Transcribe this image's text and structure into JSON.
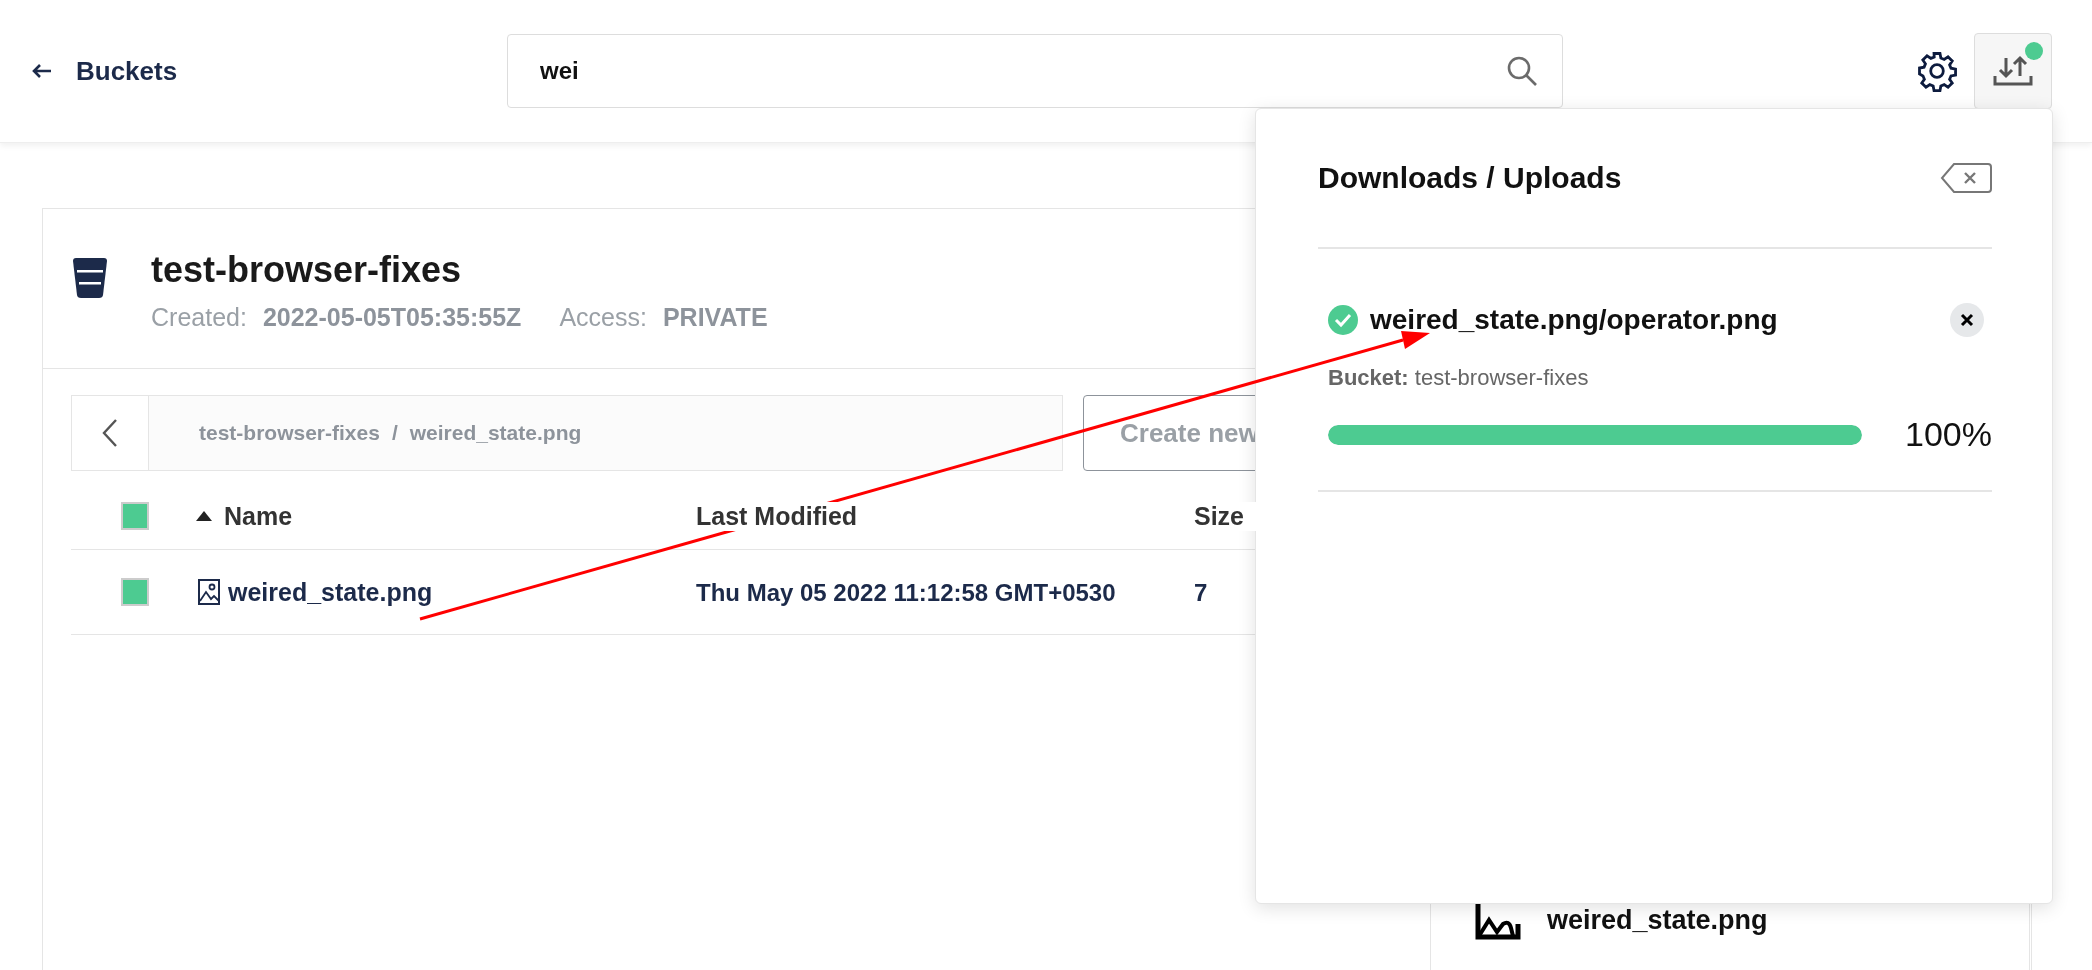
{
  "header": {
    "back_label": "Buckets",
    "search": {
      "value": "wei"
    },
    "downloads_badge": true
  },
  "bucket": {
    "name": "test-browser-fixes",
    "created_label": "Created:",
    "created": "2022-05-05T05:35:55Z",
    "access_label": "Access:",
    "access": "PRIVATE"
  },
  "breadcrumb": {
    "parts": [
      "test-browser-fixes",
      "weired_state.png"
    ],
    "separator": "/"
  },
  "create_button": "Create new",
  "table": {
    "select_all_checked": true,
    "columns": [
      {
        "label": "Name",
        "sorted": true
      },
      {
        "label": "Last Modified",
        "sorted": false
      },
      {
        "label": "Size",
        "sorted": false
      }
    ],
    "rows": [
      {
        "checked": true,
        "name": "weired_state.png",
        "modified": "Thu May 05 2022 11:12:58 GMT+0530",
        "size": "7"
      }
    ]
  },
  "panel": {
    "title": "Downloads / Uploads",
    "items": [
      {
        "completed": true,
        "name": "weired_state.png/operator.png",
        "bucket": "**Bucket:** test-browser-fixes",
        "level": 1,
        "reading": "100%"
      }
    ]
  },
  "details": {
    "name": "weired_state.png"
  },
  "annotation": {
    "kind": "arrow"
  }
}
